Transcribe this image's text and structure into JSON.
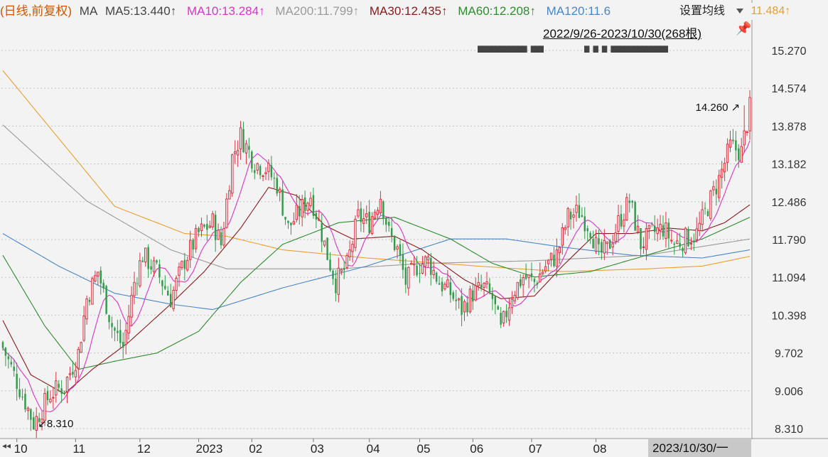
{
  "legend": {
    "period": "(日线,前复权)",
    "ma_label": "MA",
    "items": [
      {
        "text": "MA5:13.440↑",
        "color": "#444444"
      },
      {
        "text": "MA10:13.284↑",
        "color": "#d933c8"
      },
      {
        "text": "MA200:11.799↑",
        "color": "#9a9a9a"
      },
      {
        "text": "MA30:12.435↑",
        "color": "#8b1a1a"
      },
      {
        "text": "MA60:12.208↑",
        "color": "#2e8b2e"
      },
      {
        "text": "MA120:11.6",
        "color": "#4a86c8"
      }
    ],
    "clipped_value": "11.484↑",
    "clipped_value_color": "#e8a030"
  },
  "settings_label": "设置均线",
  "date_range": "2022/9/26-2023/10/30(268根)",
  "masked_text_1": "▆▆▆▆▆▆▆▆▆▆▆ ▆▆▆",
  "masked_text_2": "▆ ▆ ▆ ▆▆▆▆▆▆▆▆▆▆▆▆▆",
  "current_date": "2023/10/30/一",
  "colors": {
    "up": "#d9333f",
    "down": "#2e9c48",
    "grid": "#c4c4c4",
    "background": "#f3f3f3"
  },
  "chart_data": {
    "type": "candlestick",
    "y_axis": {
      "ticks": [
        15.27,
        14.574,
        13.878,
        13.182,
        12.486,
        11.79,
        11.094,
        10.398,
        9.702,
        9.006,
        8.31
      ],
      "tick_labels": [
        "15.270",
        "14.574",
        "13.878",
        "13.182",
        "12.486",
        "11.790",
        "11.094",
        "10.398",
        "9.702",
        "9.006",
        "8.310"
      ],
      "range": [
        8.31,
        15.27
      ]
    },
    "x_axis": {
      "tick_labels": [
        "10",
        "11",
        "12",
        "2023",
        "02",
        "03",
        "04",
        "05",
        "06",
        "07",
        "08"
      ],
      "tick_bar_index": [
        5,
        26,
        49,
        70,
        89,
        111,
        131,
        149,
        168,
        189,
        212
      ]
    },
    "bar_count": 268,
    "annotations": {
      "high": {
        "label": "14.260",
        "value": 14.26,
        "index": 265
      },
      "low": {
        "label": "8.310",
        "value": 8.31,
        "index": 11
      }
    },
    "close_anchors": [
      [
        0,
        9.8
      ],
      [
        8,
        8.8
      ],
      [
        11,
        8.4
      ],
      [
        17,
        8.95
      ],
      [
        22,
        9.1
      ],
      [
        27,
        9.7
      ],
      [
        30,
        10.7
      ],
      [
        34,
        11.2
      ],
      [
        39,
        10.2
      ],
      [
        43,
        9.8
      ],
      [
        47,
        11.0
      ],
      [
        50,
        11.5
      ],
      [
        55,
        11.2
      ],
      [
        60,
        10.7
      ],
      [
        65,
        11.4
      ],
      [
        70,
        11.9
      ],
      [
        75,
        12.1
      ],
      [
        78,
        11.7
      ],
      [
        82,
        13.3
      ],
      [
        85,
        13.7
      ],
      [
        90,
        13.2
      ],
      [
        94,
        13.1
      ],
      [
        98,
        12.8
      ],
      [
        102,
        12.0
      ],
      [
        106,
        12.3
      ],
      [
        110,
        12.6
      ],
      [
        113,
        12.1
      ],
      [
        116,
        11.5
      ],
      [
        119,
        11.0
      ],
      [
        123,
        11.3
      ],
      [
        127,
        12.2
      ],
      [
        131,
        12.1
      ],
      [
        135,
        12.6
      ],
      [
        138,
        11.9
      ],
      [
        141,
        11.6
      ],
      [
        144,
        11.0
      ],
      [
        148,
        11.3
      ],
      [
        152,
        11.4
      ],
      [
        156,
        11.0
      ],
      [
        160,
        10.8
      ],
      [
        164,
        10.5
      ],
      [
        168,
        10.8
      ],
      [
        172,
        10.9
      ],
      [
        175,
        10.7
      ],
      [
        178,
        10.1
      ],
      [
        182,
        10.8
      ],
      [
        186,
        11.1
      ],
      [
        190,
        11.0
      ],
      [
        194,
        11.3
      ],
      [
        198,
        11.5
      ],
      [
        202,
        12.2
      ],
      [
        206,
        12.3
      ],
      [
        210,
        12.0
      ],
      [
        213,
        11.5
      ],
      [
        216,
        11.6
      ],
      [
        220,
        12.1
      ],
      [
        224,
        12.5
      ],
      [
        228,
        11.7
      ],
      [
        232,
        11.9
      ],
      [
        236,
        12.0
      ],
      [
        240,
        11.7
      ],
      [
        244,
        11.8
      ],
      [
        248,
        11.9
      ],
      [
        252,
        12.4
      ],
      [
        256,
        12.9
      ],
      [
        260,
        13.5
      ],
      [
        264,
        13.4
      ],
      [
        267,
        14.2
      ]
    ],
    "ma_anchors": {
      "MA200": [
        [
          0,
          13.9
        ],
        [
          30,
          12.5
        ],
        [
          60,
          11.6
        ],
        [
          80,
          11.25
        ],
        [
          120,
          11.25
        ],
        [
          150,
          11.35
        ],
        [
          190,
          11.4
        ],
        [
          230,
          11.5
        ],
        [
          267,
          11.8
        ]
      ],
      "MA120": [
        [
          0,
          11.9
        ],
        [
          20,
          11.3
        ],
        [
          40,
          10.8
        ],
        [
          60,
          10.6
        ],
        [
          75,
          10.5
        ],
        [
          100,
          10.9
        ],
        [
          130,
          11.3
        ],
        [
          160,
          11.8
        ],
        [
          180,
          11.8
        ],
        [
          200,
          11.65
        ],
        [
          225,
          11.5
        ],
        [
          250,
          11.45
        ],
        [
          267,
          11.6
        ]
      ],
      "MA60": [
        [
          0,
          11.5
        ],
        [
          15,
          10.2
        ],
        [
          27,
          9.4
        ],
        [
          40,
          9.55
        ],
        [
          55,
          9.7
        ],
        [
          70,
          10.1
        ],
        [
          85,
          11.0
        ],
        [
          100,
          11.7
        ],
        [
          120,
          12.1
        ],
        [
          140,
          12.2
        ],
        [
          160,
          11.8
        ],
        [
          175,
          11.35
        ],
        [
          190,
          11.1
        ],
        [
          210,
          11.2
        ],
        [
          230,
          11.5
        ],
        [
          250,
          11.8
        ],
        [
          267,
          12.2
        ]
      ],
      "MA30": [
        [
          0,
          10.3
        ],
        [
          10,
          9.3
        ],
        [
          22,
          8.95
        ],
        [
          32,
          9.4
        ],
        [
          45,
          9.9
        ],
        [
          60,
          10.6
        ],
        [
          72,
          11.2
        ],
        [
          85,
          12.0
        ],
        [
          95,
          12.75
        ],
        [
          105,
          12.6
        ],
        [
          115,
          12.05
        ],
        [
          125,
          11.8
        ],
        [
          140,
          11.85
        ],
        [
          150,
          11.6
        ],
        [
          165,
          11.05
        ],
        [
          178,
          10.7
        ],
        [
          190,
          10.75
        ],
        [
          200,
          11.3
        ],
        [
          212,
          11.9
        ],
        [
          225,
          11.9
        ],
        [
          238,
          12.0
        ],
        [
          250,
          11.95
        ],
        [
          258,
          12.1
        ],
        [
          267,
          12.43
        ]
      ],
      "MA120b": [
        [
          0,
          14.9
        ],
        [
          40,
          12.4
        ],
        [
          65,
          11.9
        ],
        [
          80,
          11.85
        ],
        [
          100,
          11.6
        ],
        [
          130,
          11.45
        ],
        [
          170,
          11.3
        ],
        [
          200,
          11.2
        ],
        [
          230,
          11.25
        ],
        [
          250,
          11.3
        ],
        [
          267,
          11.48
        ]
      ]
    }
  }
}
